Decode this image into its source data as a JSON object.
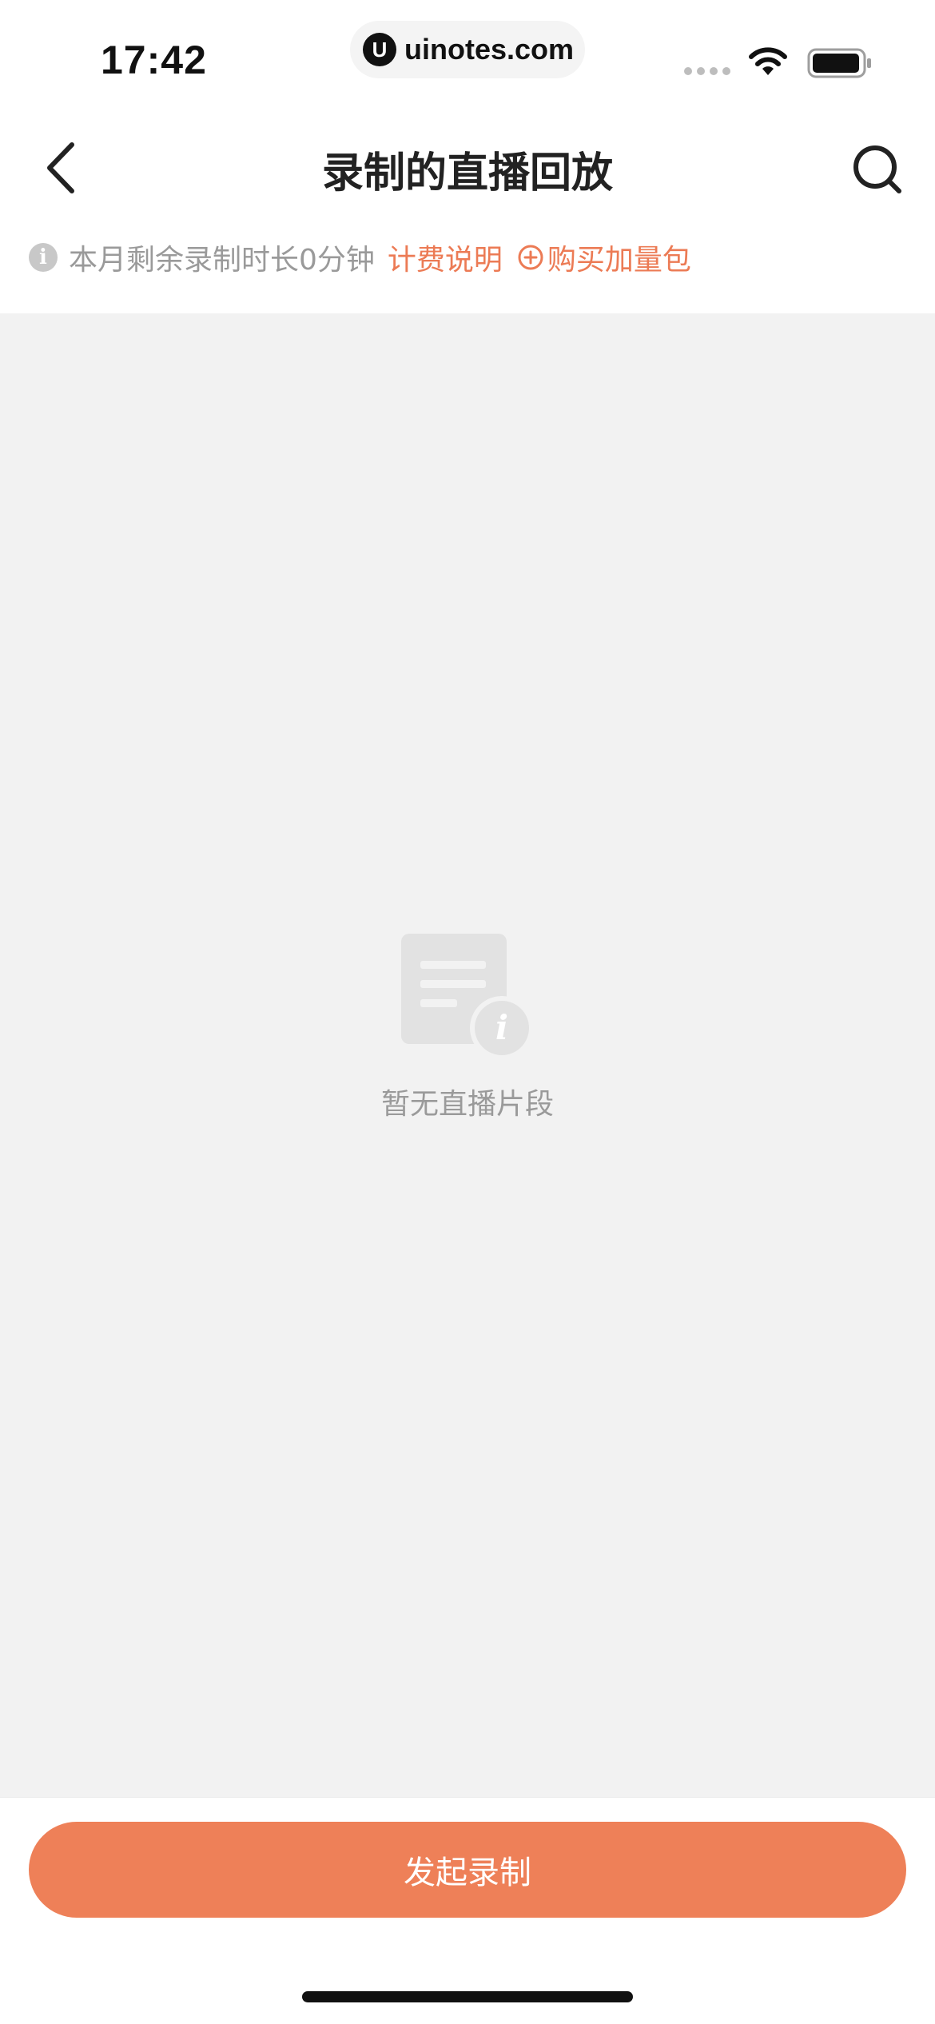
{
  "status_bar": {
    "time": "17:42",
    "url_logo": "U",
    "url": "uinotes.com"
  },
  "nav": {
    "title": "录制的直播回放",
    "back_icon": "chevron-left-icon",
    "search_icon": "search-icon"
  },
  "info": {
    "icon_glyph": "i",
    "remaining_text": "本月剩余录制时长0分钟",
    "billing_link": "计费说明",
    "buy_link": "购买加量包"
  },
  "empty_state": {
    "icon": "document-info-icon",
    "icon_glyph": "i",
    "message": "暂无直播片段"
  },
  "bottom": {
    "start_button_label": "发起录制"
  },
  "colors": {
    "accent": "#ee8058",
    "link": "#ec7b55",
    "muted_text": "#9a9a9a",
    "content_bg": "#f2f2f2"
  }
}
